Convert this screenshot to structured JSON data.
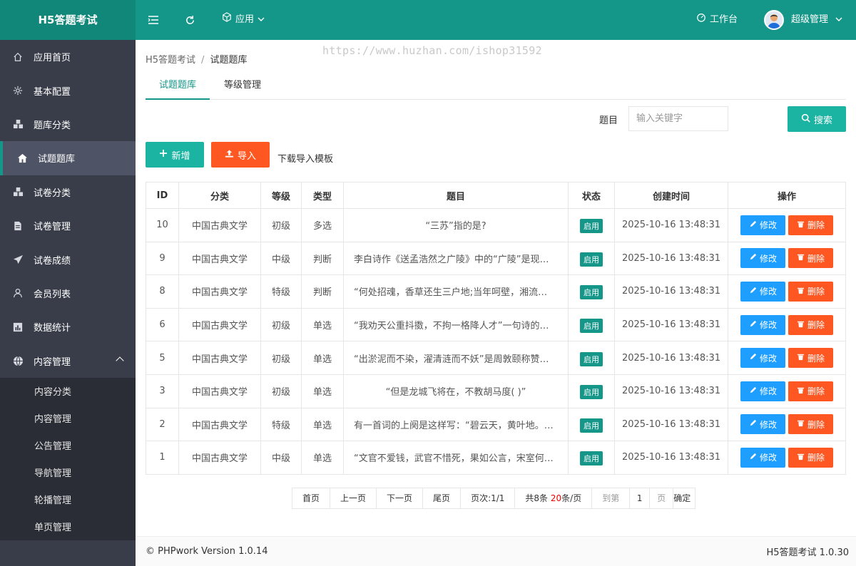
{
  "app": {
    "title": "H5答题考试"
  },
  "topbar": {
    "app_label": "应用",
    "workbench_label": "工作台",
    "user_name": "超级管理"
  },
  "sidebar": {
    "items": [
      {
        "label": "应用首页",
        "icon": "home-icon"
      },
      {
        "label": "基本配置",
        "icon": "gear-icon"
      },
      {
        "label": "题库分类",
        "icon": "cubes-icon"
      },
      {
        "label": "试题题库",
        "icon": "bank-icon"
      },
      {
        "label": "试卷分类",
        "icon": "cubes-icon"
      },
      {
        "label": "试卷管理",
        "icon": "document-icon"
      },
      {
        "label": "试卷成绩",
        "icon": "send-icon"
      },
      {
        "label": "会员列表",
        "icon": "user-icon"
      },
      {
        "label": "数据统计",
        "icon": "chart-icon"
      },
      {
        "label": "内容管理",
        "icon": "globe-icon"
      }
    ],
    "subitems": [
      "内容分类",
      "内容管理",
      "公告管理",
      "导航管理",
      "轮播管理",
      "单页管理"
    ]
  },
  "breadcrumb": {
    "root": "H5答题考试",
    "separator": "/",
    "current": "试题题库"
  },
  "watermark": "https://www.huzhan.com/ishop31592",
  "tabs": [
    "试题题库",
    "等级管理"
  ],
  "search": {
    "label": "题目",
    "placeholder": "输入关键字",
    "button": "搜索"
  },
  "actions": {
    "add": "新增",
    "import": "导入",
    "template": "下载导入模板"
  },
  "table": {
    "headers": [
      "ID",
      "分类",
      "等级",
      "类型",
      "题目",
      "状态",
      "创建时间",
      "操作"
    ],
    "rows": [
      {
        "id": "10",
        "category": "中国古典文学",
        "level": "初级",
        "type": "多选",
        "question": "“三苏”指的是?",
        "status": "启用",
        "created": "2025-10-16 13:48:31"
      },
      {
        "id": "9",
        "category": "中国古典文学",
        "level": "中级",
        "type": "判断",
        "question": "李白诗作《送孟浩然之广陵》中的“广陵”是现…",
        "status": "启用",
        "created": "2025-10-16 13:48:31"
      },
      {
        "id": "8",
        "category": "中国古典文学",
        "level": "特级",
        "type": "判断",
        "question": "“何处招魂，香草还生三户地;当年呵壁，湘流…",
        "status": "启用",
        "created": "2025-10-16 13:48:31"
      },
      {
        "id": "6",
        "category": "中国古典文学",
        "level": "初级",
        "type": "单选",
        "question": "“我劝天公重抖擞，不拘一格降人才”一句诗的…",
        "status": "启用",
        "created": "2025-10-16 13:48:31"
      },
      {
        "id": "5",
        "category": "中国古典文学",
        "level": "初级",
        "type": "单选",
        "question": "“出淤泥而不染，濯清涟而不妖”是周敦颐称赞…",
        "status": "启用",
        "created": "2025-10-16 13:48:31"
      },
      {
        "id": "3",
        "category": "中国古典文学",
        "level": "初级",
        "type": "单选",
        "question": "“但是龙城飞将在，不教胡马度( )”",
        "status": "启用",
        "created": "2025-10-16 13:48:31"
      },
      {
        "id": "2",
        "category": "中国古典文学",
        "level": "特级",
        "type": "单选",
        "question": "有一首词的上阕是这样写：“碧云天，黄叶地。…",
        "status": "启用",
        "created": "2025-10-16 13:48:31"
      },
      {
        "id": "1",
        "category": "中国古典文学",
        "level": "中级",
        "type": "单选",
        "question": "“文官不爱钱，武官不惜死，果如公言，宋室何…",
        "status": "启用",
        "created": "2025-10-16 13:48:31"
      }
    ],
    "edit_label": "修改",
    "delete_label": "删除"
  },
  "pager": {
    "first": "首页",
    "prev": "上一页",
    "next": "下一页",
    "last": "尾页",
    "page_info": "页次:1/1",
    "total_prefix": "共8条 ",
    "per_page": "20",
    "per_page_suffix": "条/页",
    "goto_label": "到第",
    "goto_value": "1",
    "page_unit": "页",
    "confirm": "确定"
  },
  "footer": {
    "left": "© PHPwork Version 1.0.14",
    "right": "H5答题考试 1.0.30"
  },
  "colors": {
    "primary": "#149688",
    "accent_orange": "#fe5722",
    "edit_blue": "#1e9fff",
    "sidebar": "#393d49"
  }
}
